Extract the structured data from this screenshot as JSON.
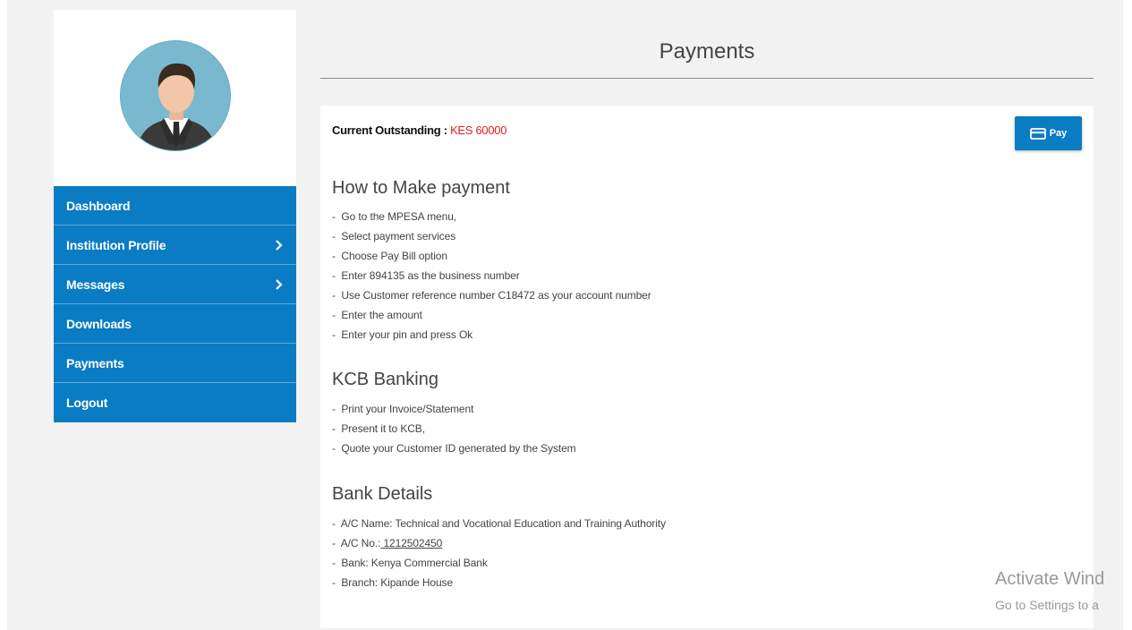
{
  "sidebar": {
    "items": [
      {
        "label": "Dashboard",
        "has_chevron": false
      },
      {
        "label": "Institution Profile",
        "has_chevron": true
      },
      {
        "label": "Messages",
        "has_chevron": true
      },
      {
        "label": "Downloads",
        "has_chevron": false
      },
      {
        "label": "Payments",
        "has_chevron": false
      },
      {
        "label": "Logout",
        "has_chevron": false
      }
    ],
    "avatar_icon": "user-avatar-icon",
    "chevron_icon": "chevron-right-icon"
  },
  "header": {
    "title": "Payments"
  },
  "outstanding": {
    "label": "Current Outstanding :",
    "amount": "KES 60000"
  },
  "pay_button": {
    "label": "Pay",
    "icon": "credit-card-icon"
  },
  "mpesa": {
    "title": "How to Make payment",
    "steps": [
      "Go to the MPESA menu,",
      "Select payment services",
      "Choose Pay Bill option",
      "Enter 894135 as the business number",
      "Use Customer reference number C18472 as your account number",
      "Enter the amount",
      "Enter your pin and press Ok"
    ]
  },
  "kcb": {
    "title": "KCB Banking",
    "steps": [
      "Print your Invoice/Statement",
      "Present it to KCB,",
      "Quote your Customer ID generated by the System"
    ]
  },
  "bank": {
    "title": "Bank Details",
    "name": "A/C Name: Technical and Vocational Education and Training Authority",
    "acno_label": "A/C No.:",
    "acno_value": " 1212502450",
    "bank": "Bank: Kenya Commercial Bank",
    "branch": "Branch: Kipande House"
  },
  "watermark": {
    "line1": "Activate Wind",
    "line2": "Go to Settings to a"
  },
  "colors": {
    "accent": "#0a7cc4",
    "amount": "#e0201b",
    "background": "#f2f2f2"
  }
}
